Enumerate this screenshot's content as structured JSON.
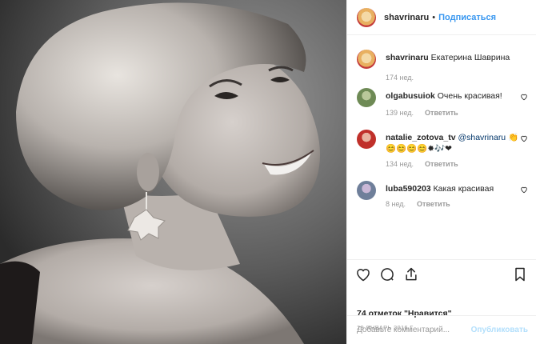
{
  "header": {
    "username": "shavrinaru",
    "dot": "•",
    "follow_label": "Подписаться"
  },
  "comments": [
    {
      "user": "shavrinaru",
      "text": "Екатерина Шаврина",
      "time": "174 нед.",
      "reply": ""
    },
    {
      "user": "olgabusuiok",
      "text": "Очень красивая!",
      "time": "139 нед.",
      "reply": "Ответить"
    },
    {
      "user": "natalie_zotova_tv",
      "mention": "@shavrinaru",
      "text": "👏",
      "text2": "😊😊😊😊✸🎶❤",
      "time": "134 нед.",
      "reply": "Ответить"
    },
    {
      "user": "luba590203",
      "text": "Какая красивая",
      "time": "8 нед.",
      "reply": "Ответить"
    }
  ],
  "actions": {
    "like_icon": "heart-icon",
    "comment_icon": "comment-icon",
    "share_icon": "share-icon",
    "save_icon": "bookmark-icon"
  },
  "likes_text": "74 отметок \"Нравится\"",
  "date": "29 ЯНВАРЬ 2016 Г.",
  "comment_box": {
    "placeholder": "Добавьте комментарий...",
    "publish_label": "Опубликовать"
  }
}
